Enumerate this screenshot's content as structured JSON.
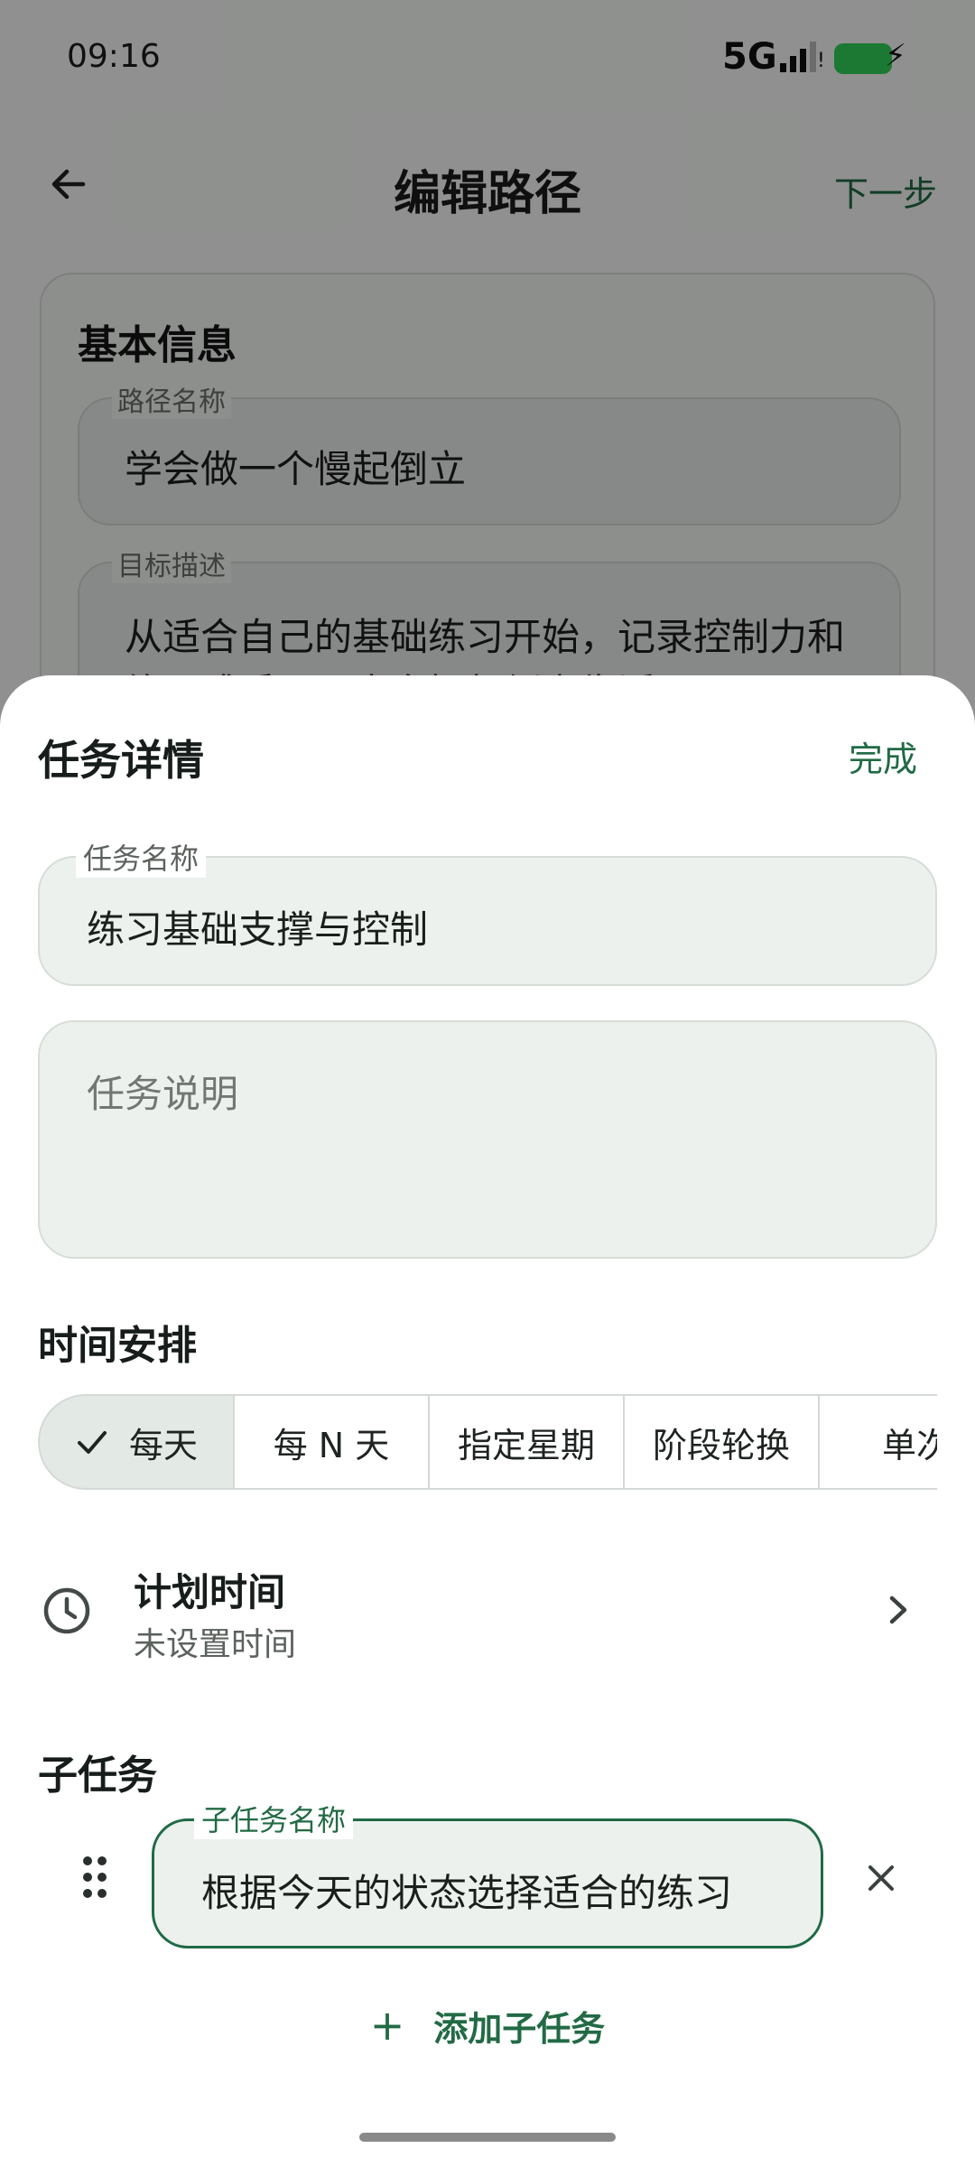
{
  "status_bar": {
    "time": "09:16",
    "network": "5G"
  },
  "top_bar": {
    "title": "编辑路径",
    "next_label": "下一步"
  },
  "basic_info": {
    "title": "基本信息",
    "path_name_label": "路径名称",
    "path_name_value": "学会做一个慢起倒立",
    "goal_label": "目标描述",
    "goal_value_line1": "从适合自己的基础练习开始，记录控制力和",
    "goal_value_line2": "练习感受，逐步向慢起倒立靠近。"
  },
  "sheet": {
    "title": "任务详情",
    "done_label": "完成",
    "task_name_label": "任务名称",
    "task_name_value": "练习基础支撑与控制",
    "task_desc_placeholder": "任务说明",
    "schedule_section_title": "时间安排",
    "schedule_options": [
      "每天",
      "每 N 天",
      "指定星期",
      "阶段轮换",
      "单次"
    ],
    "schedule_selected": "每天",
    "plan_time_title": "计划时间",
    "plan_time_sub": "未设置时间",
    "subtasks_title": "子任务",
    "subtask_name_label": "子任务名称",
    "subtask_name_value": "根据今天的状态选择适合的练习",
    "add_subtask_label": "添加子任务"
  },
  "colors": {
    "accent": "#226a45",
    "field_bg": "#ecf1ed",
    "scrim": "rgba(0,0,0,0.42)"
  }
}
